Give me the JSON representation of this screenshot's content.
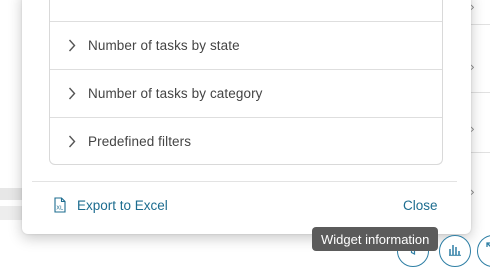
{
  "dialog": {
    "sections": [
      {
        "label": "Number of tasks by state",
        "icon": "chevron-right-icon"
      },
      {
        "label": "Number of tasks by category",
        "icon": "chevron-right-icon"
      },
      {
        "label": "Predefined filters",
        "icon": "chevron-right-icon"
      }
    ],
    "footer": {
      "export_label": "Export to Excel",
      "export_icon": "excel-file-icon",
      "close_label": "Close"
    }
  },
  "tooltip": {
    "text": "Widget information"
  },
  "toolbar": {
    "icons": [
      "filter-icon",
      "chart-bar-icon",
      "expand-icon"
    ]
  },
  "colors": {
    "link": "#1c6c8f",
    "tooltip_bg": "#5b5b5b",
    "border": "#d9d9d9"
  }
}
